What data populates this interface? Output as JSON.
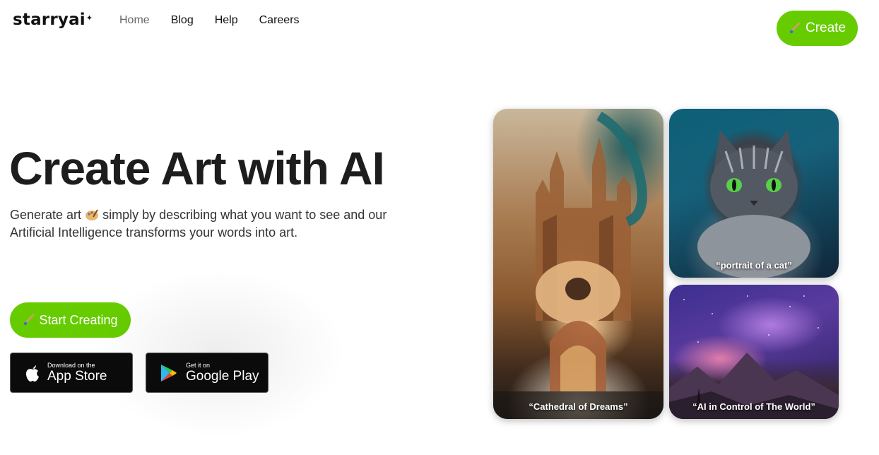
{
  "brand": {
    "logo_text": "starryai",
    "logo_spark": "✦"
  },
  "nav": {
    "items": [
      {
        "label": "Home",
        "active": true
      },
      {
        "label": "Blog",
        "active": false
      },
      {
        "label": "Help",
        "active": false
      },
      {
        "label": "Careers",
        "active": false
      }
    ]
  },
  "header": {
    "create_label": "Create"
  },
  "hero": {
    "title": "Create Art with AI",
    "subtitle_part1": "Generate art",
    "subtitle_part2": "simply by describing what you want to see and our Artificial Intelligence transforms your words into art.",
    "cta_label": "Start Creating"
  },
  "stores": {
    "apple": {
      "small": "Download on the",
      "big": "App Store"
    },
    "google": {
      "small": "Get it on",
      "big": "Google Play"
    }
  },
  "gallery": {
    "cathedral_caption": "“Cathedral of Dreams”",
    "cat_caption": "“portrait of a cat”",
    "cosmos_caption": "“AI in Control of The World”"
  },
  "colors": {
    "accent": "#66cc00",
    "store_bg": "#0b0b0b"
  }
}
